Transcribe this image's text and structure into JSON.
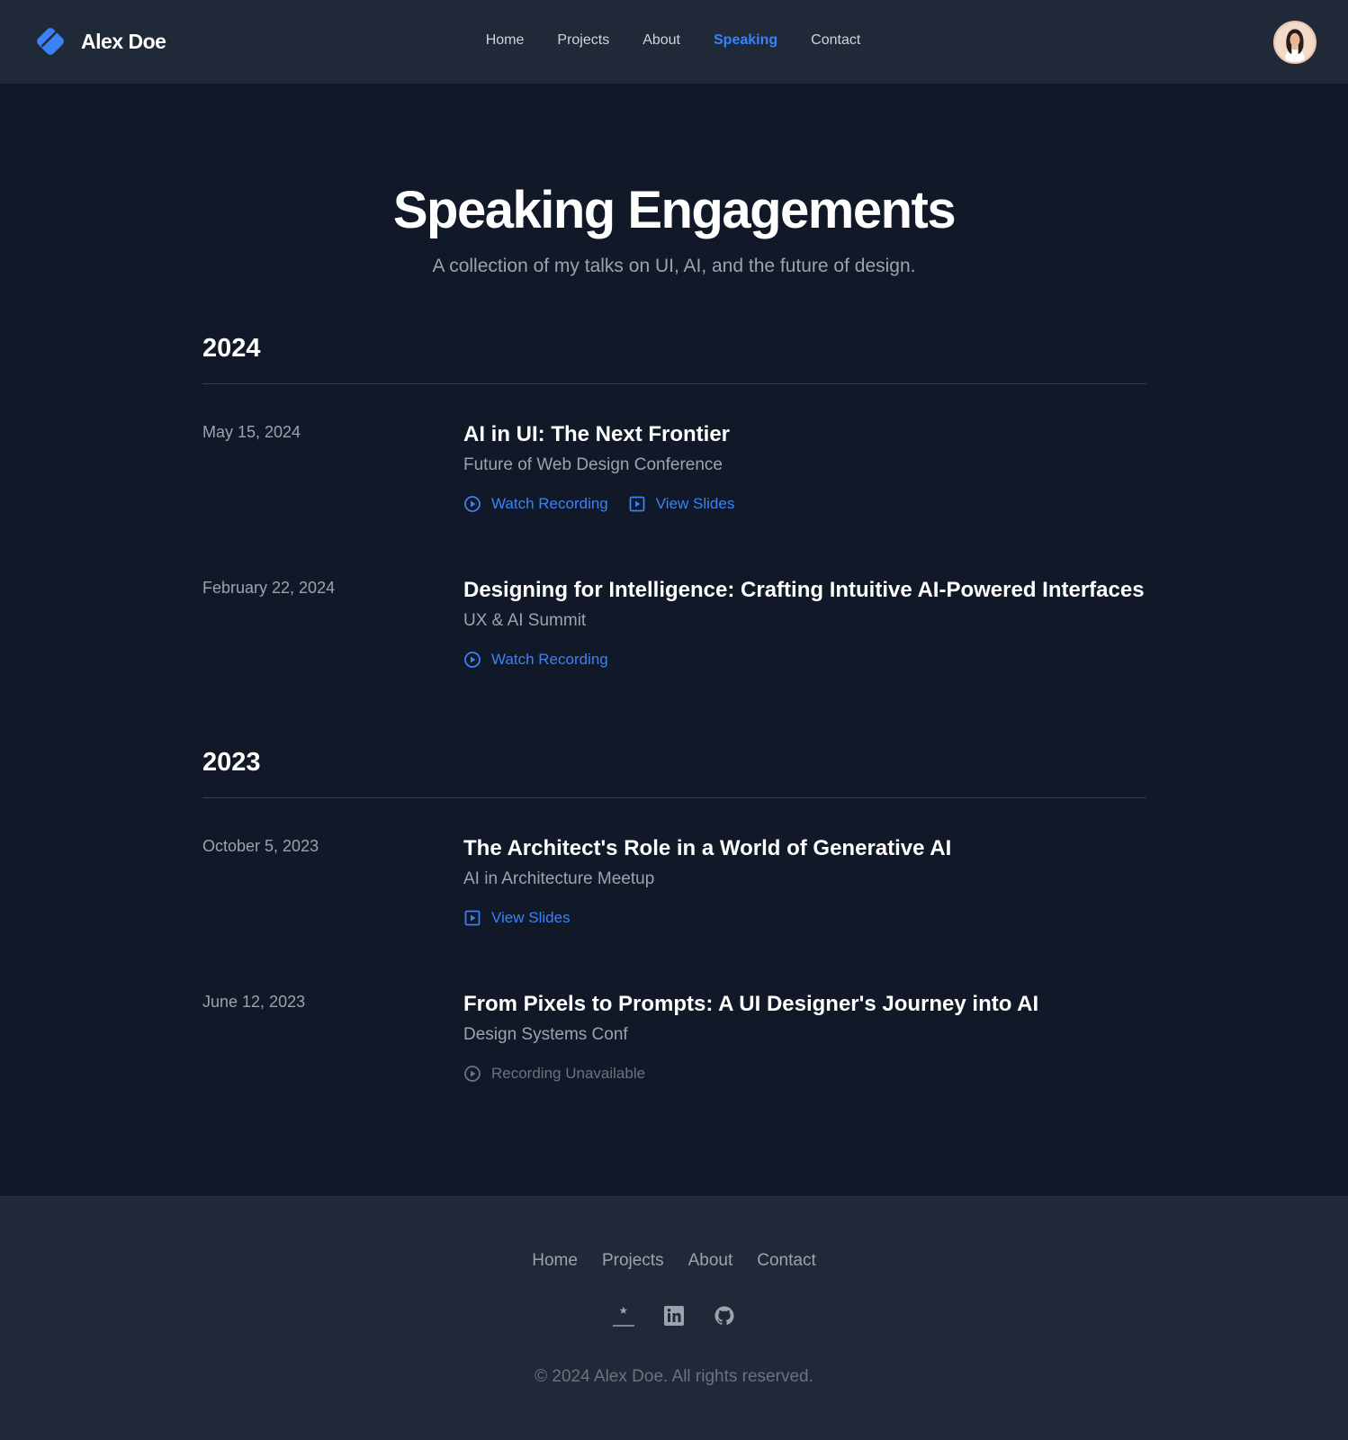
{
  "brand": {
    "name": "Alex Doe",
    "logo_icon": "diamond-logo-icon"
  },
  "nav": {
    "items": [
      {
        "label": "Home",
        "active": false
      },
      {
        "label": "Projects",
        "active": false
      },
      {
        "label": "About",
        "active": false
      },
      {
        "label": "Speaking",
        "active": true
      },
      {
        "label": "Contact",
        "active": false
      }
    ]
  },
  "hero": {
    "title": "Speaking Engagements",
    "subtitle": "A collection of my talks on UI, AI, and the future of design."
  },
  "years": [
    {
      "year": "2024",
      "talks": [
        {
          "date": "May 15, 2024",
          "title": "AI in UI: The Next Frontier",
          "event": "Future of Web Design Conference",
          "links": [
            {
              "label": "Watch Recording",
              "icon": "play-circle-icon"
            },
            {
              "label": "View Slides",
              "icon": "slides-icon"
            }
          ]
        },
        {
          "date": "February 22, 2024",
          "title": "Designing for Intelligence: Crafting Intuitive AI-Powered Interfaces",
          "event": "UX & AI Summit",
          "links": [
            {
              "label": "Watch Recording",
              "icon": "play-circle-icon"
            }
          ]
        }
      ]
    },
    {
      "year": "2023",
      "talks": [
        {
          "date": "October 5, 2023",
          "title": "The Architect's Role in a World of Generative AI",
          "event": "AI in Architecture Meetup",
          "links": [
            {
              "label": "View Slides",
              "icon": "slides-icon"
            }
          ]
        },
        {
          "date": "June 12, 2023",
          "title": "From Pixels to Prompts: A UI Designer's Journey into AI",
          "event": "Design Systems Conf",
          "links": [
            {
              "label": "Recording Unavailable",
              "icon": "play-circle-icon",
              "disabled": true
            }
          ]
        }
      ]
    }
  ],
  "footer": {
    "links": [
      "Home",
      "Projects",
      "About",
      "Contact"
    ],
    "social": [
      "dribbble-icon",
      "linkedin-icon",
      "github-icon"
    ],
    "copyright": "© 2024 Alex Doe. All rights reserved."
  },
  "colors": {
    "accent": "#3b82f6",
    "background": "#111827",
    "header_bg": "#1f2937",
    "muted_text": "#9ca3af"
  }
}
